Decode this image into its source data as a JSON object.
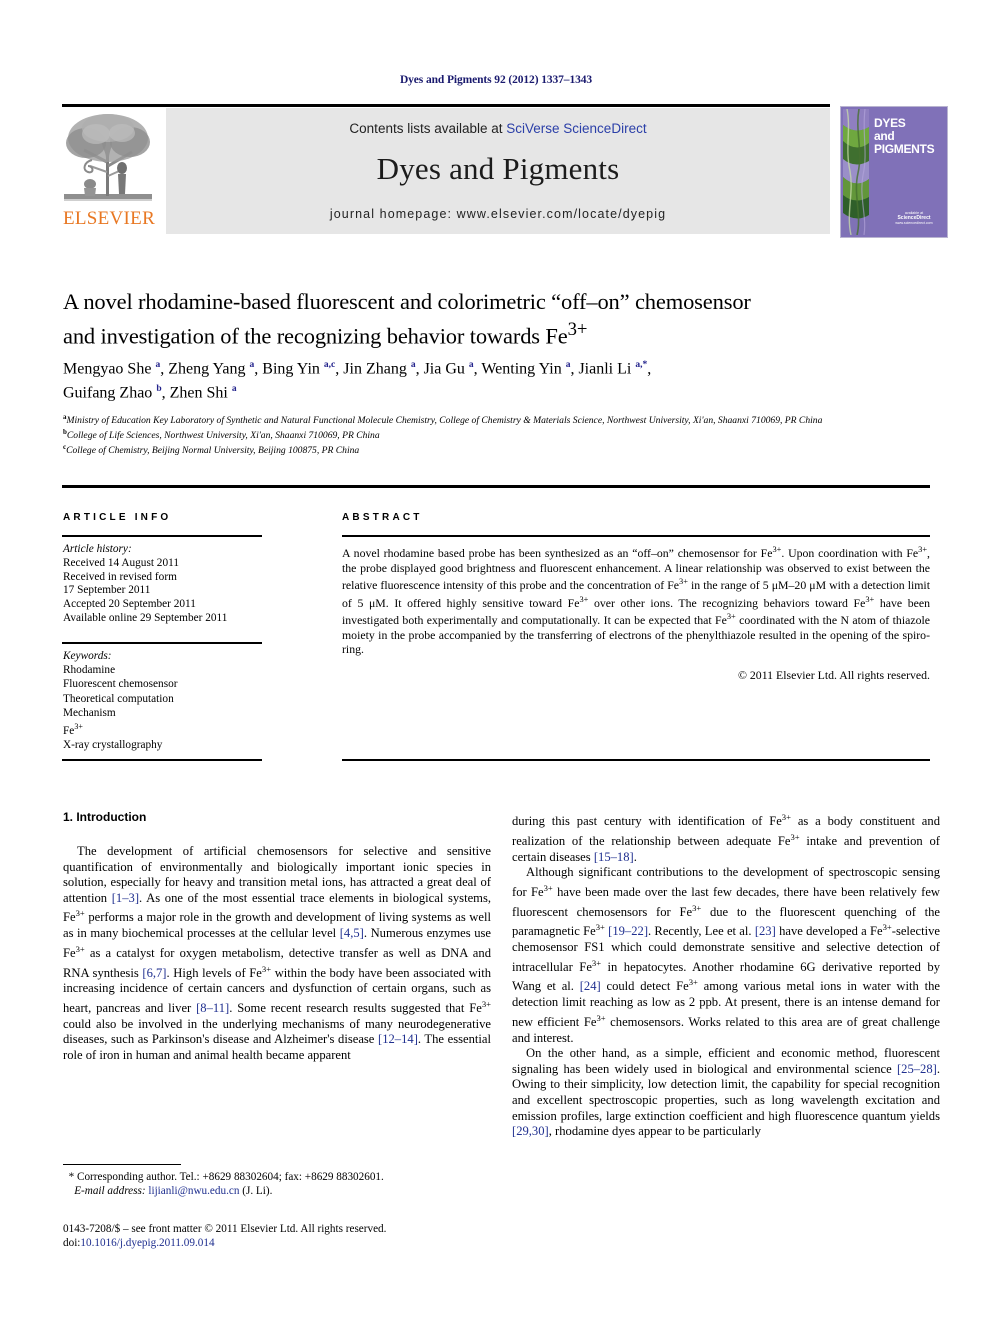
{
  "running_head": "Dyes and Pigments 92 (2012) 1337–1343",
  "masthead": {
    "publisher_name": "ELSEVIER",
    "contents_prefix": "Contents lists available at ",
    "contents_link": "SciVerse ScienceDirect",
    "journal_title": "Dyes and Pigments",
    "homepage": "journal homepage: www.elsevier.com/locate/dyepig",
    "cover": {
      "title_line1": "DYES",
      "title_line2": "and",
      "title_line3": "PIGMENTS",
      "sd_small": "available at",
      "sd_word": "ScienceDirect",
      "sd_url": "www.sciencedirect.com",
      "bg_color": "#8071b8"
    }
  },
  "article": {
    "title_line1": "A novel rhodamine-based fluorescent and colorimetric “off–on” chemosensor",
    "title_line2_pre": "and investigation of the recognizing behavior towards Fe",
    "title_line2_sup": "3+",
    "authors_line1": "Mengyao She a, Zheng Yang a, Bing Yin a,c, Jin Zhang a, Jia Gu a, Wenting Yin a, Jianli Li a,*,",
    "authors_line2": "Guifang Zhao b, Zhen Shi a",
    "affiliation_a": "Ministry of Education Key Laboratory of Synthetic and Natural Functional Molecule Chemistry, College of Chemistry & Materials Science, Northwest University, Xi'an, Shaanxi 710069, PR China",
    "affiliation_b": "College of Life Sciences, Northwest University, Xi'an, Shaanxi 710069, PR China",
    "affiliation_c": "College of Chemistry, Beijing Normal University, Beijing 100875, PR China"
  },
  "info_panel": {
    "info_heading": "ARTICLE INFO",
    "abstract_heading": "ABSTRACT",
    "history_label": "Article history:",
    "history": [
      "Received 14 August 2011",
      "Received in revised form",
      "17 September 2011",
      "Accepted 20 September 2011",
      "Available online 29 September 2011"
    ],
    "keywords_label": "Keywords:",
    "keywords": [
      "Rhodamine",
      "Fluorescent chemosensor",
      "Theoretical computation",
      "Mechanism",
      "Fe3+",
      "X-ray crystallography"
    ],
    "abstract_text": "A novel rhodamine based probe has been synthesized as an “off–on” chemosensor for Fe3+. Upon coordination with Fe3+, the probe displayed good brightness and fluorescent enhancement. A linear relationship was observed to exist between the relative fluorescence intensity of this probe and the concentration of Fe3+ in the range of 5 μM–20 μM with a detection limit of 5 μM. It offered highly sensitive toward Fe3+ over other ions. The recognizing behaviors toward Fe3+ have been investigated both experimentally and computationally. It can be expected that Fe3+ coordinated with the N atom of thiazole moiety in the probe accompanied by the transferring of electrons of the phenylthiazole resulted in the opening of the spiro-ring.",
    "copyright": "© 2011 Elsevier Ltd. All rights reserved."
  },
  "body": {
    "section_number_title": "1. Introduction",
    "left_paragraph_1": "The development of artificial chemosensors for selective and sensitive quantification of environmentally and biologically important ionic species in solution, especially for heavy and transition metal ions, has attracted a great deal of attention [1–3]. As one of the most essential trace elements in biological systems, Fe3+ performs a major role in the growth and development of living systems as well as in many biochemical processes at the cellular level [4,5]. Numerous enzymes use Fe3+ as a catalyst for oxygen metabolism, detective transfer as well as DNA and RNA synthesis [6,7]. High levels of Fe3+ within the body have been associated with increasing incidence of certain cancers and dysfunction of certain organs, such as heart, pancreas and liver [8–11]. Some recent research results suggested that Fe3+ could also be involved in the underlying mechanisms of many neurodegenerative diseases, such as Parkinson's disease and Alzheimer's disease [12–14]. The essential role of iron in human and animal health became apparent",
    "right_paragraph_1": "during this past century with identification of Fe3+ as a body constituent and realization of the relationship between adequate Fe3+ intake and prevention of certain diseases [15–18].",
    "right_paragraph_2": "Although significant contributions to the development of spectroscopic sensing for Fe3+ have been made over the last few decades, there have been relatively few fluorescent chemosensors for Fe3+ due to the fluorescent quenching of the paramagnetic Fe3+ [19–22]. Recently, Lee et al. [23] have developed a Fe3+-selective chemosensor FS1 which could demonstrate sensitive and selective detection of intracellular Fe3+ in hepatocytes. Another rhodamine 6G derivative reported by Wang et al. [24] could detect Fe3+ among various metal ions in water with the detection limit reaching as low as 2 ppb. At present, there is an intense demand for new efficient Fe3+ chemosensors. Works related to this area are of great challenge and interest.",
    "right_paragraph_3": "On the other hand, as a simple, efficient and economic method, fluorescent signaling has been widely used in biological and environmental science [25–28]. Owing to their simplicity, low detection limit, the capability for special recognition and excellent spectroscopic properties, such as long wavelength excitation and emission profiles, large extinction coefficient and high fluorescence quantum yields [29,30], rhodamine dyes appear to be particularly"
  },
  "footer": {
    "corresponding_marker": "*",
    "corresponding_text": "Corresponding author. Tel.: +8629 88302604; fax: +8629 88302601.",
    "email_label": "E-mail address:",
    "email": "lijianli@nwu.edu.cn",
    "email_owner": "(J. Li).",
    "issn_line": "0143-7208/$ – see front matter © 2011 Elsevier Ltd. All rights reserved.",
    "doi_label": "doi:",
    "doi": "10.1016/j.dyepig.2011.09.014"
  }
}
